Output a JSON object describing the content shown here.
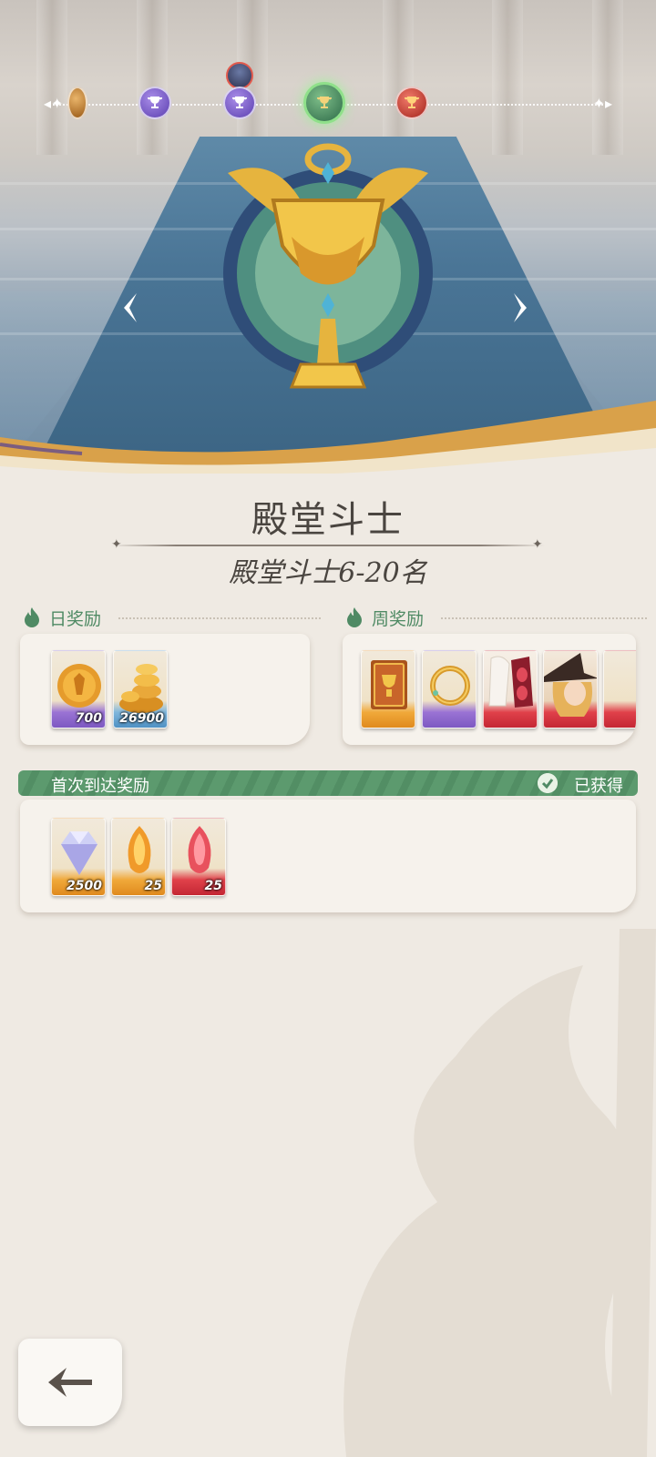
{
  "rank": {
    "title": "殿堂斗士",
    "subtitle": "殿堂斗士6-20名"
  },
  "track": {
    "nodes": [
      "partial-gold",
      "purple",
      "purple-current",
      "green-selected",
      "red"
    ],
    "current_avatar_on": 2,
    "selected": 3
  },
  "daily": {
    "label": "日奖励",
    "items": [
      {
        "icon": "gold-medal-coin-icon",
        "qty": "700",
        "rarity": "purple"
      },
      {
        "icon": "gold-coins-pile-icon",
        "qty": "26900",
        "rarity": "blue"
      }
    ]
  },
  "weekly": {
    "label": "周奖励",
    "items": [
      {
        "icon": "trophy-book-icon",
        "qty": "",
        "rarity": "gold"
      },
      {
        "icon": "golden-ring-icon",
        "qty": "",
        "rarity": "purple"
      },
      {
        "icon": "red-mask-outfit-icon",
        "qty": "",
        "rarity": "red"
      },
      {
        "icon": "witch-portrait-icon",
        "qty": "",
        "rarity": "red"
      }
    ]
  },
  "first_reach": {
    "label": "首次到达奖励",
    "status": "已获得",
    "items": [
      {
        "icon": "diamond-icon",
        "qty": "2500",
        "rarity": "gold"
      },
      {
        "icon": "orange-crystal-icon",
        "qty": "25",
        "rarity": "gold"
      },
      {
        "icon": "red-crystal-icon",
        "qty": "25",
        "rarity": "red"
      }
    ]
  },
  "colors": {
    "accent_green": "#4f8a64",
    "panel_bg": "#efeae3",
    "text_dark": "#4a4540"
  }
}
